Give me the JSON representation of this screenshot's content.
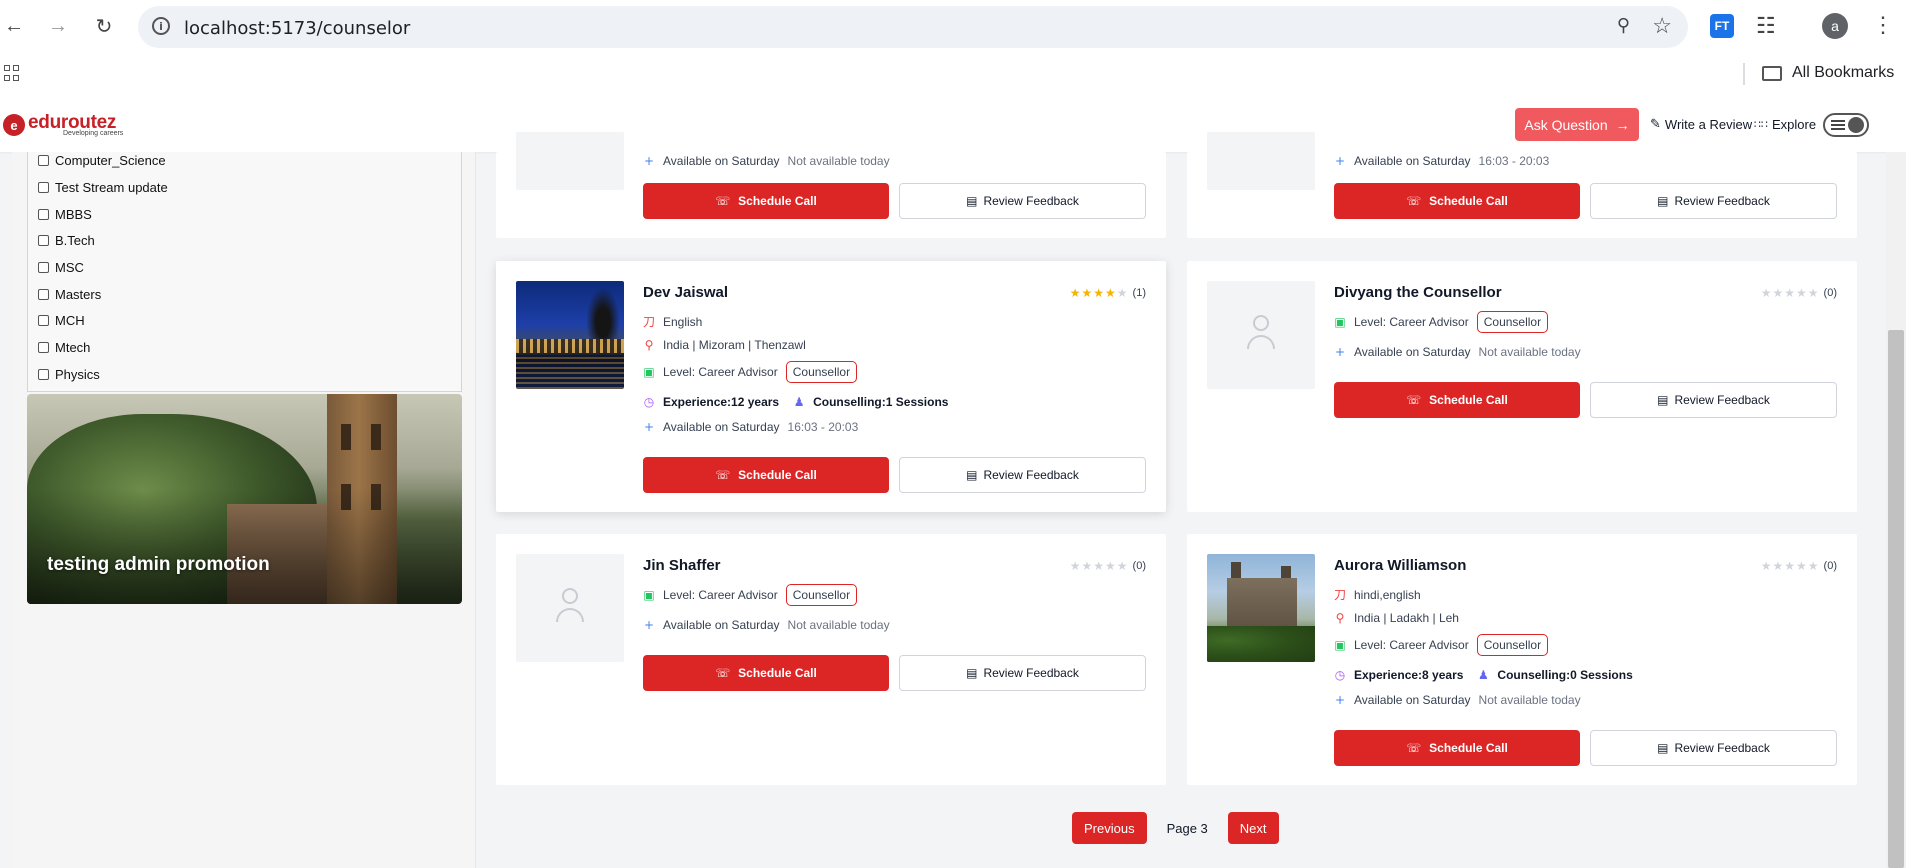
{
  "browser": {
    "url": "localhost:5173/counselor",
    "profile_initial": "a",
    "extension_badge": "FT",
    "bookmarks_label": "All Bookmarks"
  },
  "header": {
    "logo_text": "eduroutez",
    "logo_tagline": "Developing careers",
    "ask_label": "Ask Question",
    "write_review_label": "Write a Review",
    "explore_label": "Explore"
  },
  "filters": [
    {
      "label": "Computer_Science"
    },
    {
      "label": "Test Stream update"
    },
    {
      "label": "MBBS"
    },
    {
      "label": "B.Tech"
    },
    {
      "label": "MSC"
    },
    {
      "label": "Masters"
    },
    {
      "label": "MCH"
    },
    {
      "label": "Mtech"
    },
    {
      "label": "Physics"
    }
  ],
  "promo": {
    "title": "testing admin promotion"
  },
  "cards_top": [
    {
      "availability_label": "Available on Saturday",
      "availability_value": "Not available today",
      "schedule_label": "Schedule Call",
      "review_label": "Review Feedback"
    },
    {
      "availability_label": "Available on Saturday",
      "availability_value": "16:03 - 20:03",
      "schedule_label": "Schedule Call",
      "review_label": "Review Feedback"
    }
  ],
  "counselors": [
    {
      "name": "Dev Jaiswal",
      "rating_count": "(1)",
      "stars_filled": 4,
      "language": "English",
      "location": "India | Mizoram | Thenzawl",
      "level": "Level: Career Advisor",
      "role": "Counsellor",
      "experience": "Experience:12 years",
      "sessions": "Counselling:1 Sessions",
      "availability_label": "Available on Saturday",
      "availability_value": "16:03 - 20:03",
      "schedule_label": "Schedule Call",
      "review_label": "Review Feedback"
    },
    {
      "name": "Divyang the Counsellor",
      "rating_count": "(0)",
      "stars_filled": 0,
      "level": "Level: Career Advisor",
      "role": "Counsellor",
      "availability_label": "Available on Saturday",
      "availability_value": "Not available today",
      "schedule_label": "Schedule Call",
      "review_label": "Review Feedback"
    },
    {
      "name": "Jin Shaffer",
      "rating_count": "(0)",
      "stars_filled": 0,
      "level": "Level: Career Advisor",
      "role": "Counsellor",
      "availability_label": "Available on Saturday",
      "availability_value": "Not available today",
      "schedule_label": "Schedule Call",
      "review_label": "Review Feedback"
    },
    {
      "name": "Aurora Williamson",
      "rating_count": "(0)",
      "stars_filled": 0,
      "language": "hindi,english",
      "location": "India | Ladakh | Leh",
      "level": "Level: Career Advisor",
      "role": "Counsellor",
      "experience": "Experience:8 years",
      "sessions": "Counselling:0 Sessions",
      "availability_label": "Available on Saturday",
      "availability_value": "Not available today",
      "schedule_label": "Schedule Call",
      "review_label": "Review Feedback"
    }
  ],
  "pagination": {
    "previous_label": "Previous",
    "page_label": "Page 3",
    "next_label": "Next"
  },
  "colors": {
    "accent": "#dc2626",
    "ask_button": "#f05a5f",
    "brand": "#c52127"
  }
}
